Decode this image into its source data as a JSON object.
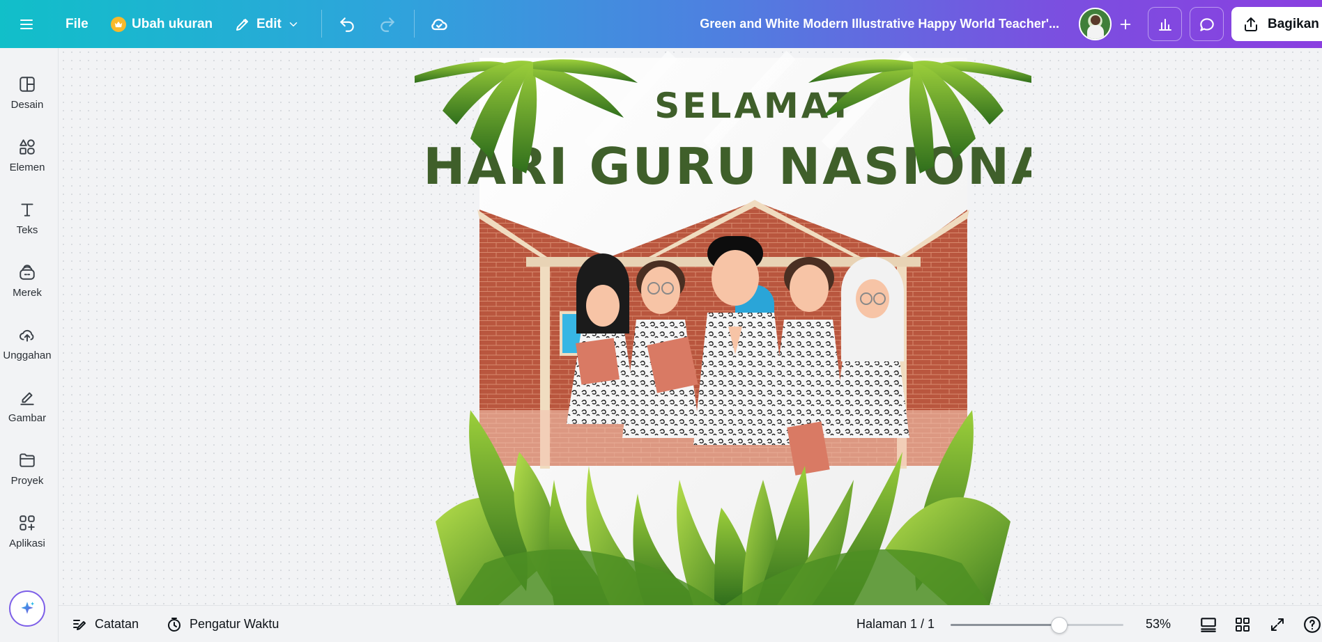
{
  "topbar": {
    "file_label": "File",
    "resize_label": "Ubah ukuran",
    "edit_label": "Edit",
    "document_title": "Green and White Modern Illustrative Happy World Teacher'...",
    "share_label": "Bagikan"
  },
  "sidebar": {
    "items": [
      {
        "label": "Desain",
        "icon": "design-icon"
      },
      {
        "label": "Elemen",
        "icon": "elements-icon"
      },
      {
        "label": "Teks",
        "icon": "text-icon"
      },
      {
        "label": "Merek",
        "icon": "brand-icon"
      },
      {
        "label": "Unggahan",
        "icon": "upload-icon"
      },
      {
        "label": "Gambar",
        "icon": "draw-icon"
      },
      {
        "label": "Proyek",
        "icon": "folder-icon"
      },
      {
        "label": "Aplikasi",
        "icon": "apps-icon"
      }
    ]
  },
  "design": {
    "greeting": "SELAMAT",
    "headline": "HARI GURU NASIONAL"
  },
  "bottombar": {
    "notes_label": "Catatan",
    "timer_label": "Pengatur Waktu",
    "page_label": "Halaman 1 / 1",
    "zoom_label": "53%",
    "zoom_fraction": 0.63
  },
  "colors": {
    "gradient_start": "#11bfc9",
    "gradient_end": "#8a3fe0",
    "headline_green": "#3f5f2a",
    "brick": "#b5523b"
  }
}
